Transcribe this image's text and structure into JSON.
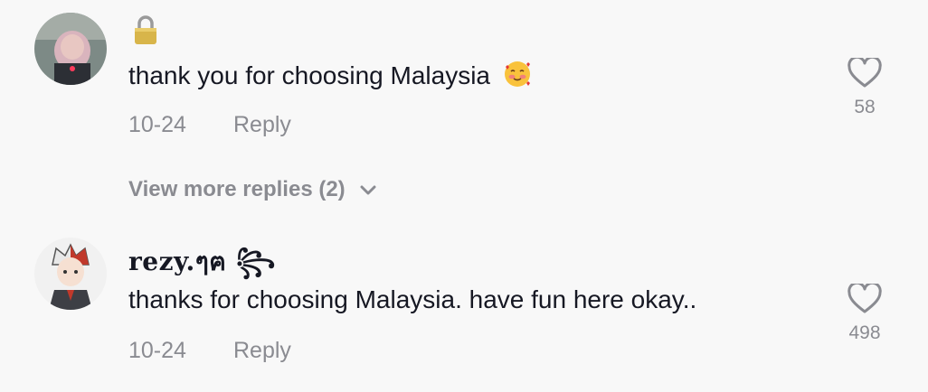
{
  "comments": [
    {
      "username_lock_icon": "lock-icon",
      "text": "thank you for choosing Malaysia",
      "emoji": "smiling-face-with-hearts-emoji",
      "date": "10-24",
      "reply_label": "Reply",
      "likes": "58"
    },
    {
      "username": "rezy.ๆฅ ꧂",
      "text": "thanks for choosing Malaysia. have fun here okay..",
      "date": "10-24",
      "reply_label": "Reply",
      "likes": "498"
    }
  ],
  "view_more": {
    "label": "View more replies (2)"
  },
  "colors": {
    "primary_text": "#161823",
    "secondary_text": "#8a8b91",
    "background": "#f8f8f8"
  }
}
